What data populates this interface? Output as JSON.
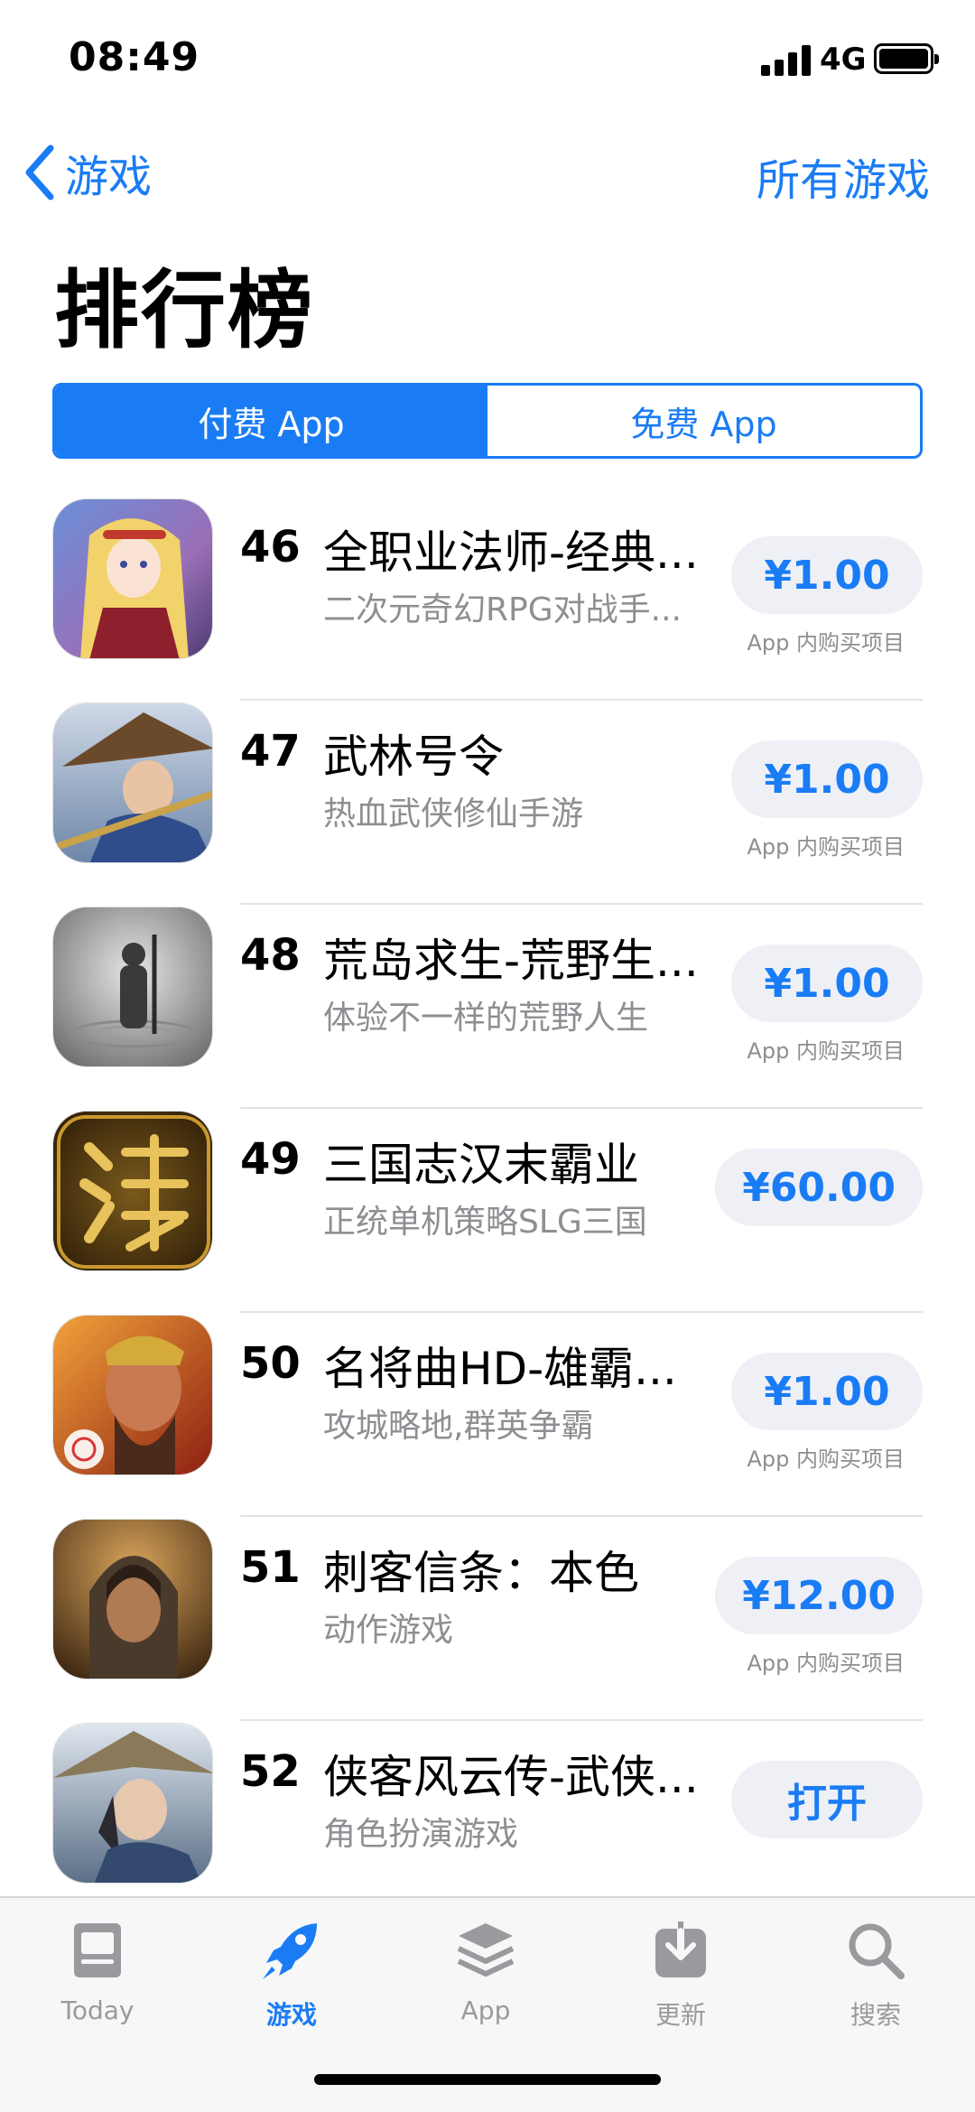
{
  "status_bar": {
    "time": "08:49",
    "network": "4G"
  },
  "nav": {
    "back_label": "游戏",
    "right_label": "所有游戏"
  },
  "page_title": "排行榜",
  "segments": [
    {
      "label": "付费 App",
      "selected": true
    },
    {
      "label": "免费 App",
      "selected": false
    }
  ],
  "apps": [
    {
      "rank": "46",
      "name": "全职业法师-经典...",
      "subtitle": "二次元奇幻RPG对战手...",
      "button": "¥1.00",
      "iap": "App 内购买项目",
      "icon": "anime-mage-girl-icon"
    },
    {
      "rank": "47",
      "name": "武林号令",
      "subtitle": "热血武侠修仙手游",
      "button": "¥1.00",
      "iap": "App 内购买项目",
      "icon": "swordsman-hat-icon"
    },
    {
      "rank": "48",
      "name": "荒岛求生-荒野生...",
      "subtitle": "体验不一样的荒野人生",
      "button": "¥1.00",
      "iap": "App 内购买项目",
      "icon": "survivor-water-icon"
    },
    {
      "rank": "49",
      "name": "三国志汉末霸业",
      "subtitle": "正统单机策略SLG三国",
      "button": "¥60.00",
      "iap": "",
      "icon": "han-character-icon"
    },
    {
      "rank": "50",
      "name": "名将曲HD-雄霸...",
      "subtitle": "攻城略地,群英争霸",
      "button": "¥1.00",
      "iap": "App 内购买项目",
      "icon": "general-warrior-icon"
    },
    {
      "rank": "51",
      "name": "刺客信条：本色",
      "subtitle": "动作游戏",
      "button": "¥12.00",
      "iap": "App 内购买项目",
      "icon": "assassin-hood-icon"
    },
    {
      "rank": "52",
      "name": "侠客风云传-武侠...",
      "subtitle": "角色扮演游戏",
      "button": "打开",
      "iap": "",
      "icon": "wuxia-hero-icon"
    }
  ],
  "tabs": [
    {
      "label": "Today",
      "icon": "today-icon",
      "active": false
    },
    {
      "label": "游戏",
      "icon": "rocket-icon",
      "active": true
    },
    {
      "label": "App",
      "icon": "layers-icon",
      "active": false
    },
    {
      "label": "更新",
      "icon": "download-icon",
      "active": false
    },
    {
      "label": "搜索",
      "icon": "search-icon",
      "active": false
    }
  ],
  "colors": {
    "accent": "#1a7cf5",
    "button_bg": "#eef0f5",
    "secondary_text": "#8e8e93"
  }
}
